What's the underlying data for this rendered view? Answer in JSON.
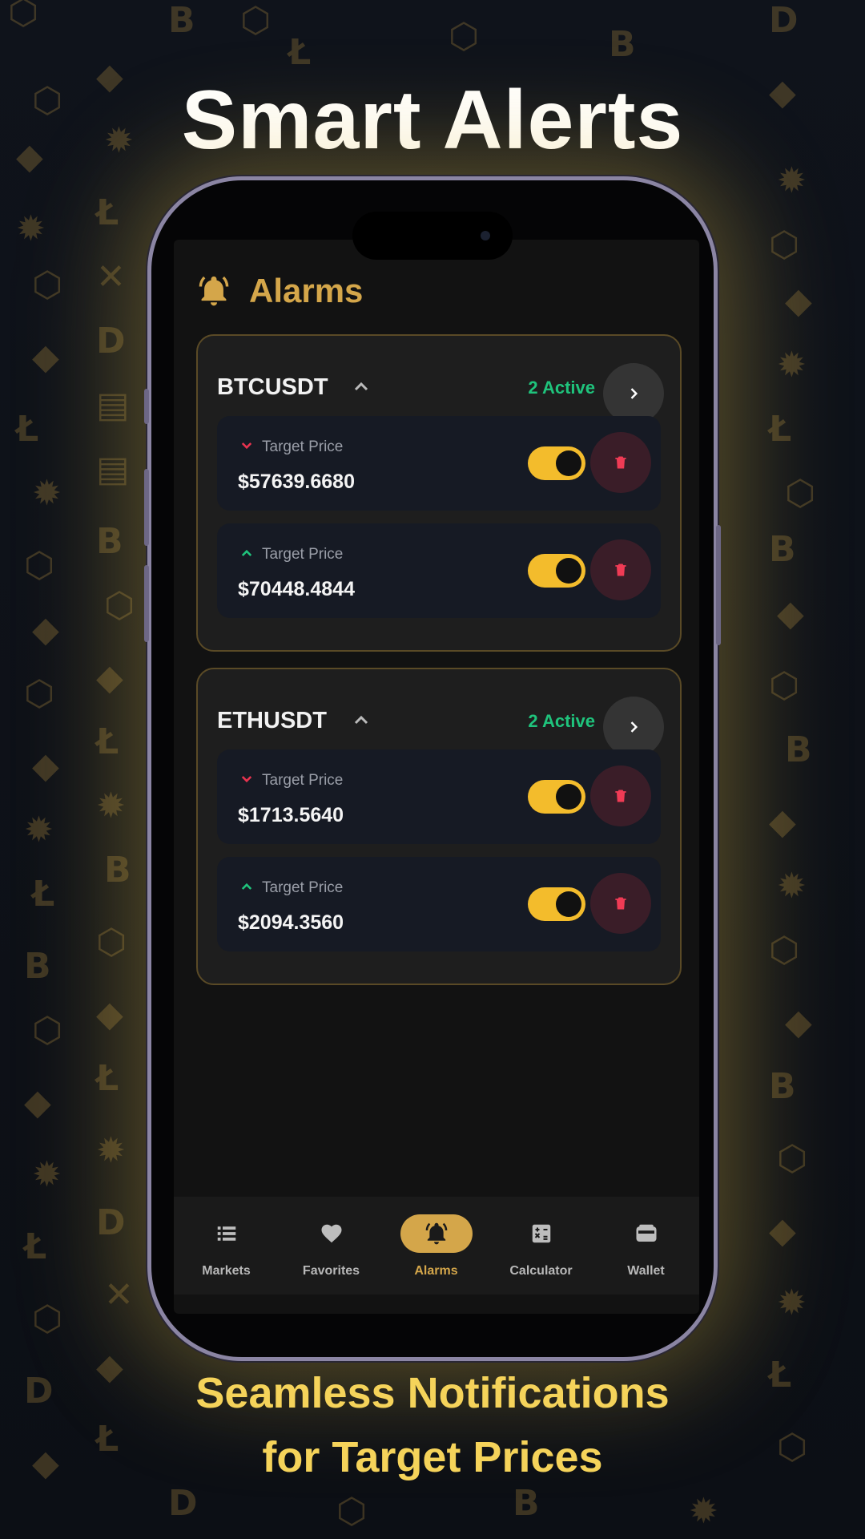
{
  "promo": {
    "headline": "Smart Alerts",
    "tagline_line1": "Seamless Notifications",
    "tagline_line2": "for Target Prices"
  },
  "app": {
    "title": "Alarms",
    "title_icon": "bell-icon"
  },
  "groups": [
    {
      "pair": "BTCUSDT",
      "active_label": "2 Active",
      "alarms": [
        {
          "direction": "down",
          "label": "Target Price",
          "price": "$57639.6680",
          "enabled": true
        },
        {
          "direction": "up",
          "label": "Target Price",
          "price": "$70448.4844",
          "enabled": true
        }
      ]
    },
    {
      "pair": "ETHUSDT",
      "active_label": "2 Active",
      "alarms": [
        {
          "direction": "down",
          "label": "Target Price",
          "price": "$1713.5640",
          "enabled": true
        },
        {
          "direction": "up",
          "label": "Target Price",
          "price": "$2094.3560",
          "enabled": true
        }
      ]
    }
  ],
  "bottom_nav": [
    {
      "label": "Markets",
      "icon": "list-icon",
      "active": false
    },
    {
      "label": "Favorites",
      "icon": "heart-icon",
      "active": false
    },
    {
      "label": "Alarms",
      "icon": "bell-icon",
      "active": true
    },
    {
      "label": "Calculator",
      "icon": "calculator-icon",
      "active": false
    },
    {
      "label": "Wallet",
      "icon": "wallet-icon",
      "active": false
    }
  ],
  "colors": {
    "accent_gold": "#d4a64a",
    "toggle_on": "#f3bc2c",
    "active_green": "#1fc37c",
    "down_red": "#e8334f",
    "up_green": "#1fc37c",
    "tagline_yellow": "#f5d35a"
  }
}
